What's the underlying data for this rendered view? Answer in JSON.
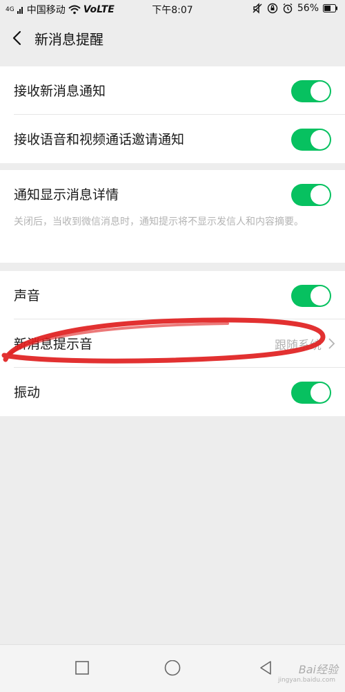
{
  "status_bar": {
    "signal": "4G",
    "carrier": "中国移动",
    "network": "VoLTE",
    "time": "下午8:07",
    "battery": "56%"
  },
  "nav": {
    "title": "新消息提醒"
  },
  "settings": {
    "receive_new_msg": {
      "label": "接收新消息通知",
      "enabled": true
    },
    "receive_call_invite": {
      "label": "接收语音和视频通话邀请通知",
      "enabled": true
    },
    "show_details": {
      "label": "通知显示消息详情",
      "enabled": true,
      "description": "关闭后，当收到微信消息时，通知提示将不显示发信人和内容摘要。"
    },
    "sound": {
      "label": "声音",
      "enabled": true
    },
    "new_msg_tone": {
      "label": "新消息提示音",
      "value": "跟随系统"
    },
    "vibration": {
      "label": "振动",
      "enabled": true
    }
  },
  "colors": {
    "toggle_on": "#07c160",
    "annotation": "#e02020"
  },
  "icons": {
    "back": "back-arrow-icon",
    "chevron": "chevron-right-icon",
    "home": "circle-home-icon",
    "recents": "square-recents-icon",
    "back_sys": "triangle-back-icon"
  },
  "watermark": {
    "text": "Bai经验",
    "sub": "jingyan.baidu.com"
  }
}
